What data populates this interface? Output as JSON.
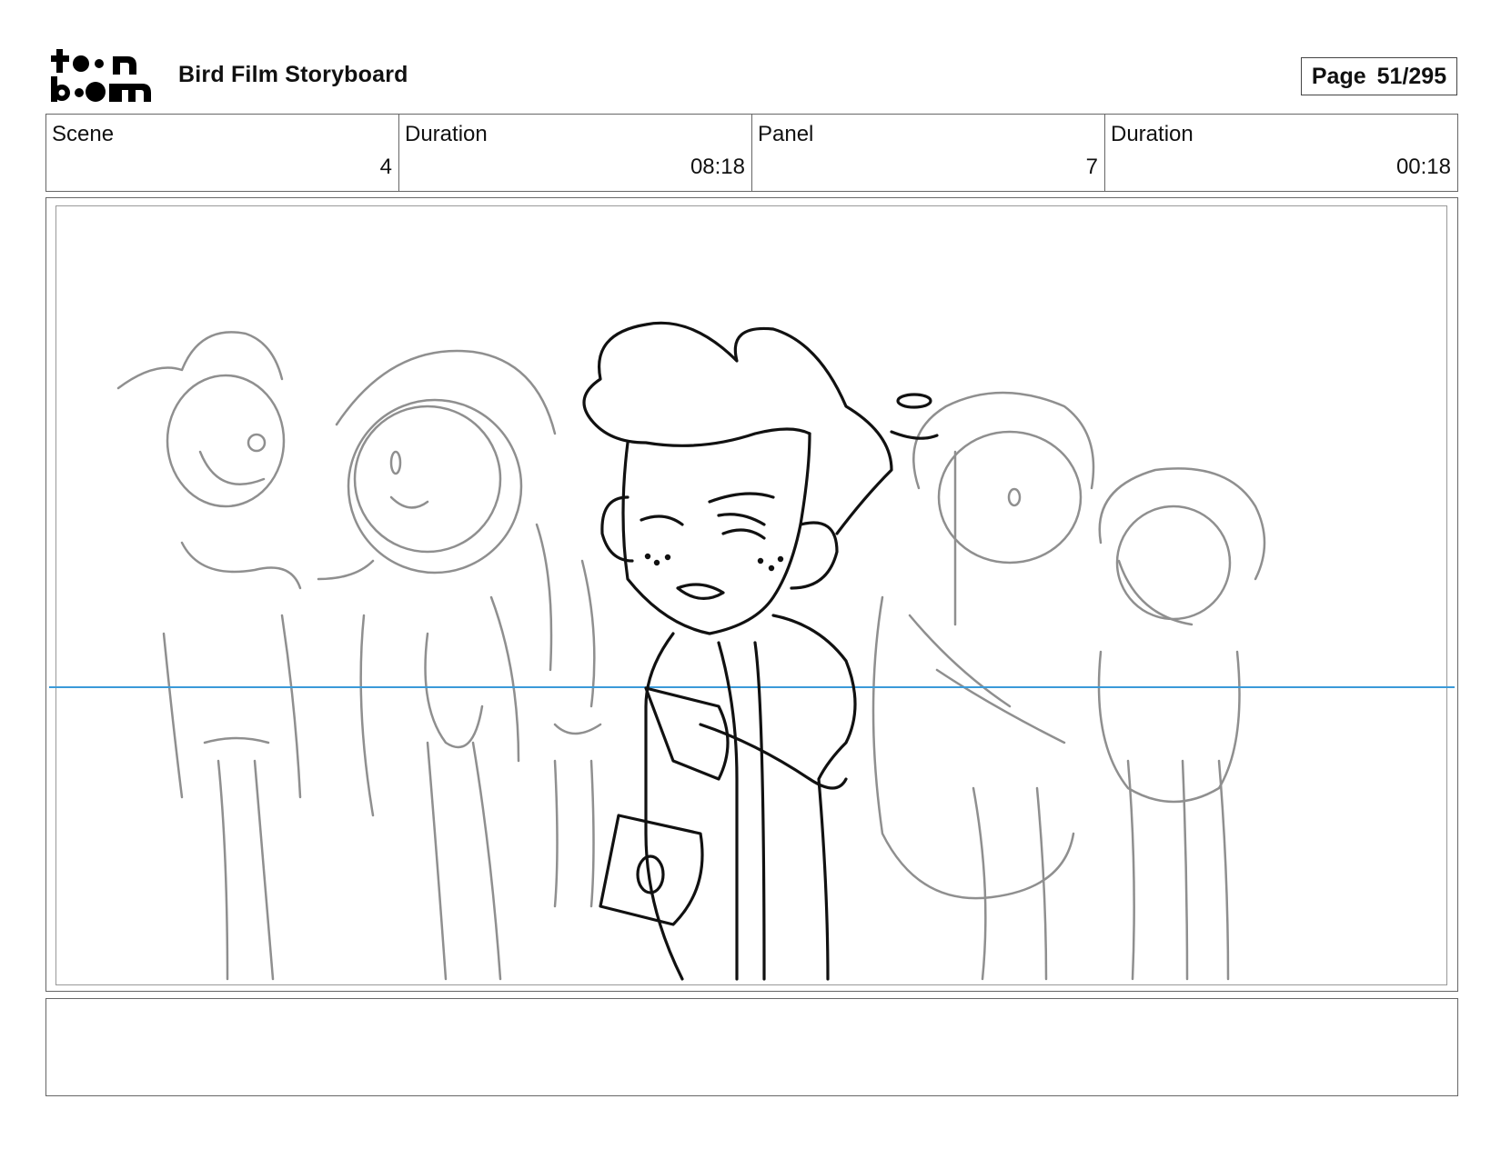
{
  "header": {
    "logo_text": "toon boom",
    "title": "Bird Film Storyboard",
    "page_label": "Page",
    "page_value": "51/295"
  },
  "info": {
    "scene_label": "Scene",
    "scene_value": "4",
    "scene_duration_label": "Duration",
    "scene_duration_value": "08:18",
    "panel_label": "Panel",
    "panel_value": "7",
    "panel_duration_label": "Duration",
    "panel_duration_value": "00:18"
  },
  "panel": {
    "horizon_color": "#3a9ad9",
    "rough_stroke_color": "#8f8f8f",
    "clean_stroke_color": "#111111"
  },
  "caption": {
    "text": ""
  }
}
